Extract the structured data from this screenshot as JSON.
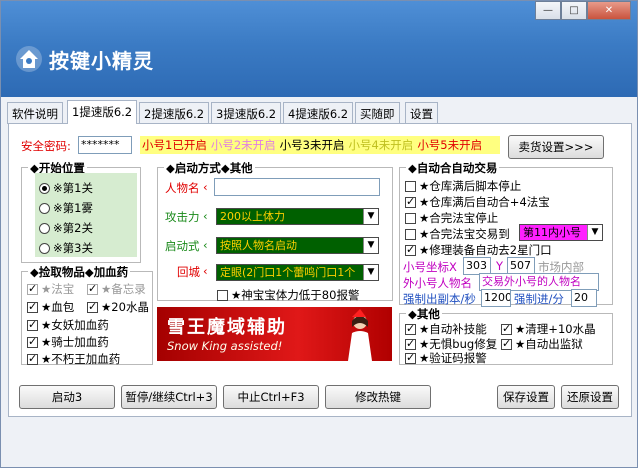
{
  "window": {
    "app_title": "按键小精灵",
    "buttons": {
      "minimize": "—",
      "maximize": "□",
      "close": "✕"
    }
  },
  "tabs": [
    {
      "label": "软件说明"
    },
    {
      "label": "1提速版6.2"
    },
    {
      "label": "2提速版6.2"
    },
    {
      "label": "3提速版6.2"
    },
    {
      "label": "4提速版6.2"
    },
    {
      "label": "买随即"
    },
    {
      "label": "设置"
    }
  ],
  "password": {
    "label": "安全密码:",
    "value": "*******"
  },
  "accounts": [
    {
      "label": "小号1已开启",
      "color": "#e00000"
    },
    {
      "label": "小号2未开启",
      "color": "#e080e0"
    },
    {
      "label": "小号3未开启",
      "color": "#000000"
    },
    {
      "label": "小号4未开启",
      "color": "#e0e040"
    },
    {
      "label": "小号5未开启",
      "color": "#e00000"
    }
  ],
  "sell_settings_button": "卖货设置>>>",
  "start_position": {
    "title": "◆开始位置",
    "options": [
      {
        "label": "※第1关",
        "selected": true
      },
      {
        "label": "※第1雾",
        "selected": false
      },
      {
        "label": "※第2关",
        "selected": false
      },
      {
        "label": "※第3关",
        "selected": false
      }
    ]
  },
  "pickup": {
    "title": "◆捡取物品◆加血药",
    "items": [
      {
        "label": "★法宝",
        "checked": true,
        "disabled": true
      },
      {
        "label": "★备忘录",
        "checked": true,
        "disabled": true
      },
      {
        "label": "★血包",
        "checked": true,
        "disabled": false
      },
      {
        "label": "★20水晶",
        "checked": true,
        "disabled": false
      },
      {
        "label": "★女妖加血药",
        "checked": true,
        "disabled": false
      },
      {
        "label": "★骑士加血药",
        "checked": true,
        "disabled": false
      },
      {
        "label": "★不朽王加血药",
        "checked": true,
        "disabled": false
      }
    ]
  },
  "auto_method": {
    "title": "◆启动方式◆其他",
    "character_label": "人物名",
    "character_value": "",
    "attack_label": "攻击力",
    "attack_value": "200以上体力",
    "start_label": "启动式",
    "start_value": "按照人物名启动",
    "return_label": "回城",
    "return_value": "定眼(2门口1个蕾鸣门口1个",
    "dragon_check": {
      "label": "★神宝宝体力低于80报警",
      "checked": false
    }
  },
  "banner": {
    "title": "雪王魔域辅助",
    "subtitle": "Snow King assisted!"
  },
  "auto_trade": {
    "title": "◆自动合自动交易",
    "items": [
      {
        "label": "★仓库满后脚本停止",
        "checked": false
      },
      {
        "label": "★仓库满后自动合+4法宝",
        "checked": true
      },
      {
        "label": "★合完法宝停止",
        "checked": false
      },
      {
        "label": "★合完法宝交易到",
        "checked": false
      },
      {
        "label": "★修理装备自动去2星门口",
        "checked": true
      }
    ],
    "trade_target": "第11内小号",
    "coord_label": "小号坐标X",
    "coord_x": "303",
    "coord_y_label": "Y",
    "coord_y": "507",
    "coord_suffix": "市场内部",
    "name_label": "外小号人物名",
    "name_placeholder": "交易外小号的人物名",
    "force_label": "强制出副本/秒",
    "force_value": "1200",
    "force_progress_label": "强制进/分",
    "force_progress_value": "20"
  },
  "other": {
    "title": "◆其他",
    "items": [
      {
        "label": "★自动补技能",
        "checked": true
      },
      {
        "label": "★清理+10水晶",
        "checked": true
      },
      {
        "label": "★无惧bug修复",
        "checked": true
      },
      {
        "label": "★自动出监狱",
        "checked": true
      },
      {
        "label": "★验证码报警",
        "checked": true
      }
    ]
  },
  "footer": {
    "start": "启动3",
    "pause": "暂停/继续Ctrl+3",
    "stop": "中止Ctrl+F3",
    "hotkey": "修改热键",
    "save": "保存设置",
    "restore": "还原设置"
  }
}
